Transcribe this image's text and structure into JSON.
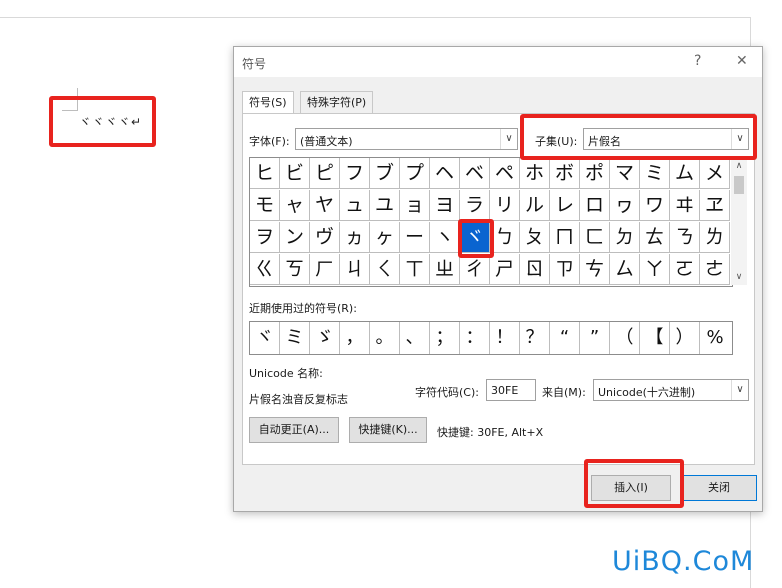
{
  "document": {
    "text": "ヾヾヾヾ↵"
  },
  "dialog": {
    "title": "符号",
    "help_icon": "?",
    "close_icon": "✕",
    "tabs": [
      {
        "label": "符号(S)"
      },
      {
        "label": "特殊字符(P)"
      }
    ],
    "font_label": "字体(F):",
    "font_value": "(普通文本)",
    "subset_label": "子集(U):",
    "subset_value": "片假名",
    "grid_rows": [
      [
        "ヒ",
        "ビ",
        "ピ",
        "フ",
        "ブ",
        "プ",
        "ヘ",
        "ベ",
        "ペ",
        "ホ",
        "ボ",
        "ポ",
        "マ",
        "ミ",
        "ム",
        "メ"
      ],
      [
        "モ",
        "ャ",
        "ヤ",
        "ュ",
        "ユ",
        "ョ",
        "ヨ",
        "ラ",
        "リ",
        "ル",
        "レ",
        "ロ",
        "ヮ",
        "ワ",
        "ヰ",
        "ヱ"
      ],
      [
        "ヲ",
        "ン",
        "ヴ",
        "ヵ",
        "ヶ",
        "ー",
        "ヽ",
        "ヾ",
        "ㄅ",
        "ㄆ",
        "ㄇ",
        "ㄈ",
        "ㄉ",
        "ㄊ",
        "ㄋ",
        "ㄌ"
      ],
      [
        "ㄍ",
        "ㄎ",
        "ㄏ",
        "ㄐ",
        "ㄑ",
        "ㄒ",
        "ㄓ",
        "ㄔ",
        "ㄕ",
        "ㄖ",
        "ㄗ",
        "ㄘ",
        "ㄙ",
        "ㄚ",
        "ㄛ",
        "ㄜ"
      ]
    ],
    "selected_char": "ヾ",
    "recent_label": "近期使用过的符号(R):",
    "recent": [
      "ヾ",
      "ミ",
      "ゞ",
      "，",
      "。",
      "、",
      "；",
      "：",
      "！",
      "？",
      "“",
      "”",
      "（",
      "【",
      "）",
      "%"
    ],
    "unicode_name_label": "Unicode 名称:",
    "unicode_name_value": "片假名浊音反复标志",
    "charcode_label": "字符代码(C):",
    "charcode_value": "30FE",
    "from_label": "来自(M):",
    "from_value": "Unicode(十六进制)",
    "autocorrect_button": "自动更正(A)...",
    "shortcut_button": "快捷键(K)...",
    "shortcut_text": "快捷键: 30FE, Alt+X",
    "insert_button": "插入(I)",
    "close_button": "关闭"
  },
  "watermark": "UiBQ.CoM",
  "colors": {
    "highlight": "#e8231e",
    "selection": "#0a64d0",
    "watermark": "#1e88d9"
  }
}
